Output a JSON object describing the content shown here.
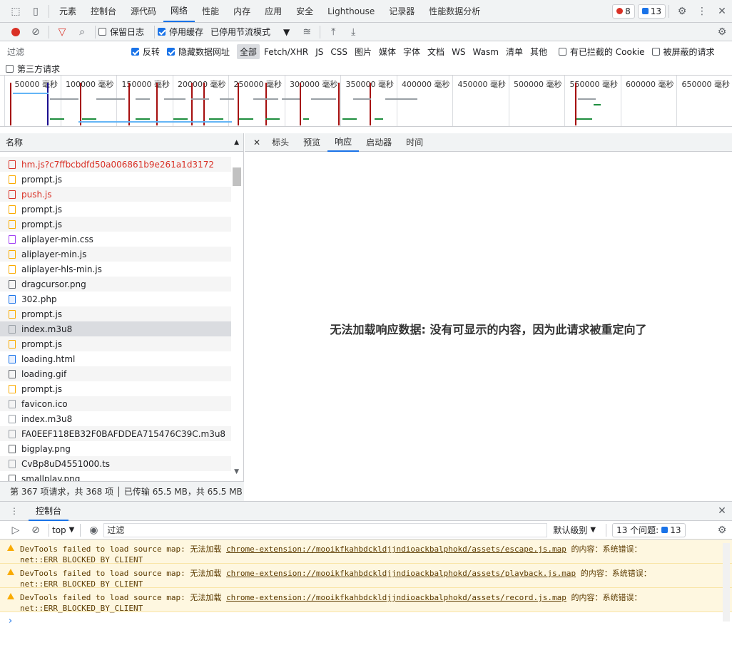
{
  "toolbar": {
    "tabs": [
      "元素",
      "控制台",
      "源代码",
      "网络",
      "性能",
      "内存",
      "应用",
      "安全",
      "Lighthouse",
      "记录器",
      "性能数据分析"
    ],
    "active_tab": "网络",
    "errors": "8",
    "issues": "13"
  },
  "netbar": {
    "preserve_log": "保留日志",
    "disable_cache": "停用缓存",
    "throttle": "已停用节流模式"
  },
  "filter": {
    "placeholder": "过滤",
    "invert": "反转",
    "hide_data_urls": "隐藏数据网址",
    "types": [
      "全部",
      "Fetch/XHR",
      "JS",
      "CSS",
      "图片",
      "媒体",
      "字体",
      "文档",
      "WS",
      "Wasm",
      "清单",
      "其他"
    ],
    "blocked_cookies": "有已拦截的 Cookie",
    "blocked_requests": "被屏蔽的请求",
    "third_party": "第三方请求"
  },
  "timeline": {
    "ticks": [
      "50000 毫秒",
      "100000 毫秒",
      "150000 毫秒",
      "200000 毫秒",
      "250000 毫秒",
      "300000 毫秒",
      "350000 毫秒",
      "400000 毫秒",
      "450000 毫秒",
      "500000 毫秒",
      "550000 毫秒",
      "600000 毫秒",
      "650000 毫秒"
    ]
  },
  "list": {
    "header": "名称",
    "rows": [
      {
        "name": "hm.js?c7ffbcbdfd50a006861b9e261a1d3172",
        "type": "red",
        "error": true
      },
      {
        "name": "prompt.js",
        "type": "js"
      },
      {
        "name": "push.js",
        "type": "red",
        "error": true
      },
      {
        "name": "prompt.js",
        "type": "js"
      },
      {
        "name": "prompt.js",
        "type": "js"
      },
      {
        "name": "aliplayer-min.css",
        "type": "css"
      },
      {
        "name": "aliplayer-min.js",
        "type": "js"
      },
      {
        "name": "aliplayer-hls-min.js",
        "type": "js"
      },
      {
        "name": "dragcursor.png",
        "type": "img"
      },
      {
        "name": "302.php",
        "type": "doc"
      },
      {
        "name": "prompt.js",
        "type": "js"
      },
      {
        "name": "index.m3u8",
        "type": "other",
        "selected": true
      },
      {
        "name": "prompt.js",
        "type": "js"
      },
      {
        "name": "loading.html",
        "type": "doc"
      },
      {
        "name": "loading.gif",
        "type": "img"
      },
      {
        "name": "prompt.js",
        "type": "js"
      },
      {
        "name": "favicon.ico",
        "type": "other"
      },
      {
        "name": "index.m3u8",
        "type": "other"
      },
      {
        "name": "FA0EEF118EB32F0BAFDDEA715476C39C.m3u8",
        "type": "other"
      },
      {
        "name": "bigplay.png",
        "type": "img"
      },
      {
        "name": "CvBp8uD4551000.ts",
        "type": "other"
      },
      {
        "name": "smallplay.png",
        "type": "img"
      }
    ],
    "status": "第 367 项请求，共 368 项 │ 已传输 65.5 MB，共 65.5 MB"
  },
  "detail": {
    "tabs": [
      "标头",
      "预览",
      "响应",
      "启动器",
      "时间"
    ],
    "active": "响应",
    "message": "无法加载响应数据: 没有可显示的内容，因为此请求被重定向了"
  },
  "console": {
    "tab": "控制台",
    "context": "top",
    "filter_placeholder": "过滤",
    "level": "默认级别",
    "issues_label": "13 个问题:",
    "issues_count": "13",
    "messages": [
      {
        "prefix": "DevTools failed to load source map: 无法加载 ",
        "url": "chrome-extension://mooikfkahbdckldjjndioackbalphokd/assets/escape.js.map",
        "suffix": " 的内容：系统错误：",
        "line2": "net::ERR_BLOCKED_BY_CLIENT"
      },
      {
        "prefix": "DevTools failed to load source map: 无法加载 ",
        "url": "chrome-extension://mooikfkahbdckldjjndioackbalphokd/assets/playback.js.map",
        "suffix": " 的内容：系统错误：",
        "line2": "net::ERR_BLOCKED_BY_CLIENT"
      },
      {
        "prefix": "DevTools failed to load source map: 无法加载 ",
        "url": "chrome-extension://mooikfkahbdckldjjndioackbalphokd/assets/record.js.map",
        "suffix": " 的内容：系统错误：",
        "line2": "net::ERR_BLOCKED_BY_CLIENT"
      }
    ]
  }
}
